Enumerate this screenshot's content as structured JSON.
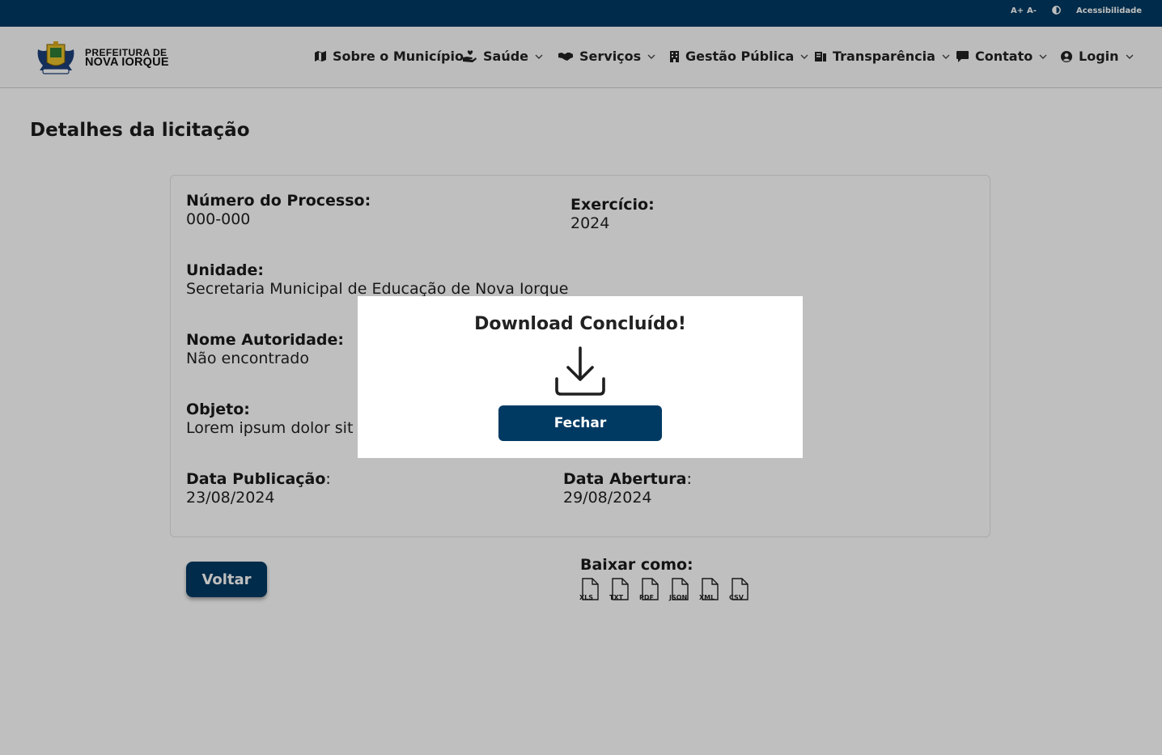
{
  "accessibility_bar": {
    "increase_font": "A+",
    "decrease_font": "A-",
    "accessibility_label": "Acessibilidade",
    "contrast_icon": "contrast-icon"
  },
  "header": {
    "brand_line1": "PREFEITURA DE",
    "brand_line2": "NOVA IORQUE",
    "logo_icon": "coat-of-arms-logo",
    "nav": [
      {
        "label": "Sobre o Município",
        "icon": "map-icon",
        "dropdown": false
      },
      {
        "label": "Saúde",
        "icon": "hand-heart-icon",
        "dropdown": true
      },
      {
        "label": "Serviços",
        "icon": "handshake-icon",
        "dropdown": true
      },
      {
        "label": "Gestão Pública",
        "icon": "building-icon",
        "dropdown": true
      },
      {
        "label": "Transparência",
        "icon": "document-icon",
        "dropdown": true
      },
      {
        "label": "Contato",
        "icon": "chat-icon",
        "dropdown": true
      },
      {
        "label": "Login",
        "icon": "user-circle-icon",
        "dropdown": true
      }
    ]
  },
  "page": {
    "title": "Detalhes da licitação",
    "fields": {
      "numero_processo": {
        "label": "Número do Processo:",
        "value": "000-000"
      },
      "exercicio": {
        "label": "Exercício:",
        "value": "2024"
      },
      "unidade": {
        "label": "Unidade:",
        "value": "Secretaria Municipal de Educação de Nova Iorque"
      },
      "nome_autoridade": {
        "label": "Nome Autoridade:",
        "value": "Não encontrado"
      },
      "objeto": {
        "label": "Objeto:",
        "value": "Lorem ipsum dolor sit ar"
      },
      "data_publicacao": {
        "label": "Data Publicação",
        "value": "23/08/2024"
      },
      "data_abertura": {
        "label": "Data Abertura",
        "value": "29/08/2024"
      }
    },
    "colon": ":",
    "back_button": "Voltar",
    "download": {
      "title": "Baixar como:",
      "formats": [
        "XLS",
        "TXT",
        "PDF",
        "JSON",
        "XML",
        "CSV"
      ]
    }
  },
  "modal": {
    "title": "Download Concluído!",
    "icon": "download-icon",
    "close_button": "Fechar"
  },
  "colors": {
    "primary": "#003a63",
    "overlay": "rgba(0,0,0,0.25)"
  }
}
